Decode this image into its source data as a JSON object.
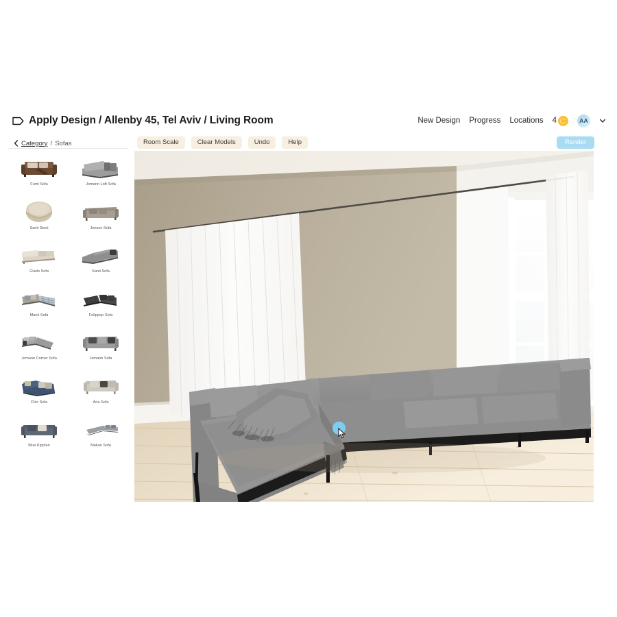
{
  "header": {
    "logo_icon": "tag-outline-icon",
    "title": "Apply Design / Allenby 45, Tel Aviv / Living Room",
    "nav": [
      {
        "label": "New Design",
        "name": "new-design"
      },
      {
        "label": "Progress",
        "name": "progress"
      },
      {
        "label": "Locations",
        "name": "locations"
      }
    ],
    "credits": {
      "count": "4",
      "icon": "coin-icon"
    },
    "avatar": {
      "initials": "AA"
    },
    "chevron_icon": "chevron-down-icon"
  },
  "subbar": {
    "back_icon": "chevron-left-icon",
    "breadcrumb_link": "Category",
    "breadcrumb_sep": "/",
    "breadcrumb_current": "Sofas",
    "tools": [
      {
        "label": "Room Scale",
        "name": "room-scale"
      },
      {
        "label": "Clear Models",
        "name": "clear-models"
      },
      {
        "label": "Undo",
        "name": "undo"
      },
      {
        "label": "Help",
        "name": "help"
      }
    ],
    "render_label": "Render"
  },
  "sidebar": {
    "models": [
      {
        "label": "Fumi Sofa",
        "style": "brown-wood-sofa"
      },
      {
        "label": "Jomann Loft Sofa",
        "style": "grey-loft-sectional"
      },
      {
        "label": "Santi Stool",
        "style": "beige-stool"
      },
      {
        "label": "Jenson Sofa",
        "style": "taupe-sofa"
      },
      {
        "label": "Glado Sofa",
        "style": "cream-chaise"
      },
      {
        "label": "Santi Sofa",
        "style": "grey-corner-sectional"
      },
      {
        "label": "Mank Sofa",
        "style": "patterned-sectional"
      },
      {
        "label": "Felippep Sofa",
        "style": "dark-sectional"
      },
      {
        "label": "Jomann Corner Sofa",
        "style": "grey-corner-sofa"
      },
      {
        "label": "Jomann Sofa",
        "style": "grey-3seat-sofa"
      },
      {
        "label": "Chic Sofa",
        "style": "navy-chaise-sofa"
      },
      {
        "label": "Aria Sofa",
        "style": "light-grey-loveseat"
      },
      {
        "label": "Blue Kipplan",
        "style": "blue-grey-sofa"
      },
      {
        "label": "Makan Sofa",
        "style": "grey-low-sectional"
      }
    ]
  },
  "canvas": {
    "scene": "living-room-3d-render",
    "placed_model": "grey-sectional-sofa",
    "selection_handle": "selection-dot",
    "cursor": "mouse-pointer"
  },
  "colors": {
    "toolbar_bg": "#f7efdf",
    "render_bg": "#a9dcf2",
    "coin": "#fac02e",
    "avatar": "#a8d5ef",
    "wall": "#b3a996",
    "floor": "#e4d6bf",
    "sofa": "#8d8d8d",
    "handle": "#7ecdf0"
  }
}
